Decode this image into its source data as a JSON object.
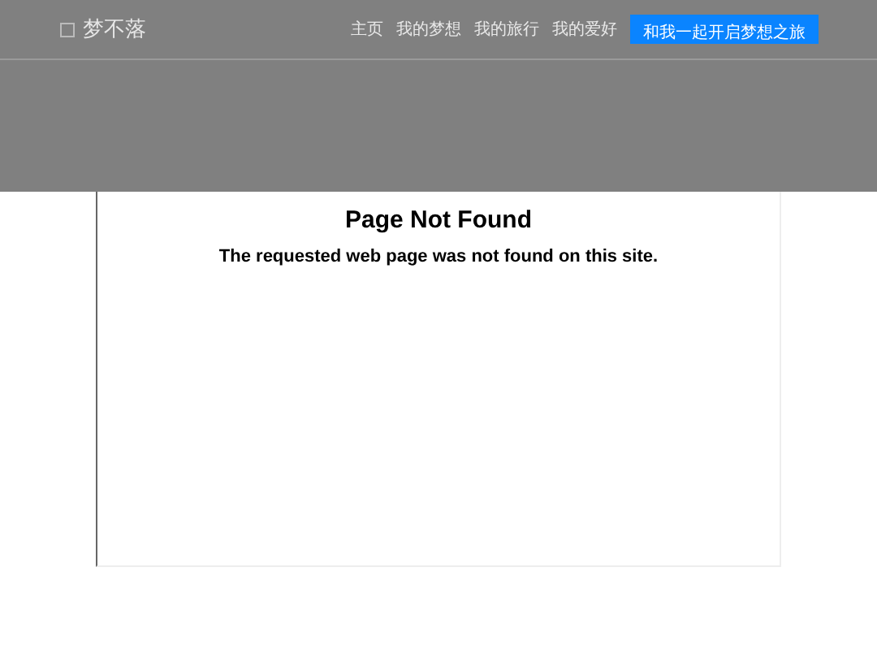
{
  "brand": {
    "name": "梦不落"
  },
  "nav": {
    "items": [
      "主页",
      "我的梦想",
      "我的旅行",
      "我的爱好"
    ],
    "cta": "和我一起开启梦想之旅"
  },
  "content": {
    "title": "Page Not Found",
    "message": "The requested web page was not found on this site."
  }
}
